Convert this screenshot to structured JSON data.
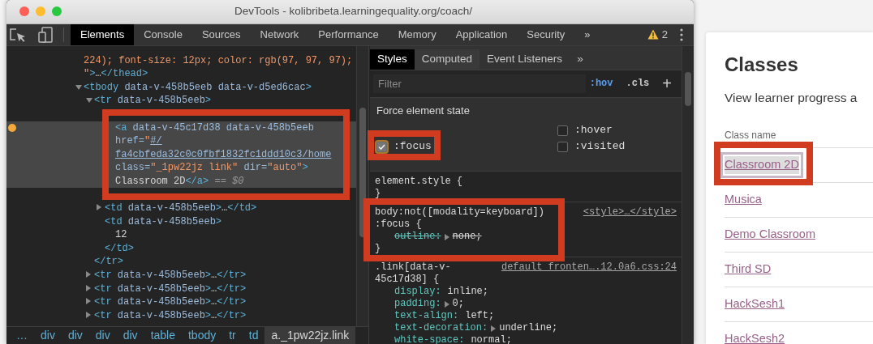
{
  "window": {
    "title": "DevTools - kolibribeta.learningequality.org/coach/"
  },
  "panel_tabs": [
    {
      "label": "Elements",
      "selected": true
    },
    {
      "label": "Console",
      "selected": false
    },
    {
      "label": "Sources",
      "selected": false
    },
    {
      "label": "Network",
      "selected": false
    },
    {
      "label": "Performance",
      "selected": false
    },
    {
      "label": "Memory",
      "selected": false
    },
    {
      "label": "Application",
      "selected": false
    },
    {
      "label": "Security",
      "selected": false
    }
  ],
  "more_tabs": "»",
  "warnings": {
    "count": "2"
  },
  "dom_tree": [
    {
      "selected": false,
      "lines": [
        [
          {
            "kind": "value",
            "text": "224); font-size: 12px; color: rgb(97, 97, 97);"
          }
        ],
        [
          {
            "kind": "value",
            "text": "\""
          },
          {
            "kind": "tag",
            "text": ">"
          },
          {
            "kind": "text",
            "text": "…"
          },
          {
            "kind": "tag",
            "text": "</thead>"
          }
        ]
      ]
    },
    {
      "selected": false,
      "expanded": true,
      "lines": [
        [
          {
            "kind": "tag",
            "text": "<tbody"
          },
          {
            "kind": "attr",
            "text": " data-v-458b5eeb data-v-d5ed6cac"
          },
          {
            "kind": "tag",
            "text": ">"
          }
        ]
      ],
      "children": [
        {
          "selected": false,
          "expanded": true,
          "lines": [
            [
              {
                "kind": "tag",
                "text": "<tr"
              },
              {
                "kind": "attr",
                "text": " data-v-458b5eeb"
              },
              {
                "kind": "tag",
                "text": ">"
              }
            ]
          ],
          "children": [
            {
              "selected": false,
              "marked": true,
              "children": [
                {
                  "selected": true,
                  "lines": [
                    [
                      {
                        "kind": "tag",
                        "text": "<a"
                      },
                      {
                        "kind": "attr",
                        "text": " data-v-45c17d38 data-v-458b5eeb"
                      }
                    ],
                    [
                      {
                        "kind": "attr",
                        "text": "href="
                      },
                      {
                        "kind": "value",
                        "text": "\""
                      },
                      {
                        "kind": "link",
                        "text": "#/"
                      }
                    ],
                    [
                      {
                        "kind": "link",
                        "text": "fa4cbfeda32c0c0fbf1832fc1ddd10c3/home"
                      }
                    ],
                    [
                      {
                        "kind": "attr",
                        "text": "class="
                      },
                      {
                        "kind": "value",
                        "text": "\"_1pw22jz link\""
                      },
                      {
                        "kind": "attr",
                        "text": " dir="
                      },
                      {
                        "kind": "value",
                        "text": "\"auto\""
                      },
                      {
                        "kind": "tag",
                        "text": ">"
                      }
                    ],
                    [
                      {
                        "kind": "text",
                        "text": "Classroom 2D"
                      },
                      {
                        "kind": "tag",
                        "text": "</a>"
                      },
                      {
                        "kind": "dim",
                        "text": " == "
                      },
                      {
                        "kind": "var",
                        "text": "$0"
                      }
                    ]
                  ]
                }
              ]
            },
            {
              "selected": false,
              "expanded": false,
              "lines": [
                [
                  {
                    "kind": "tag",
                    "text": "<td"
                  },
                  {
                    "kind": "attr",
                    "text": " data-v-458b5eeb"
                  },
                  {
                    "kind": "tag",
                    "text": ">"
                  },
                  {
                    "kind": "text",
                    "text": "…"
                  },
                  {
                    "kind": "tag",
                    "text": "</td>"
                  }
                ]
              ]
            },
            {
              "selected": false,
              "lines": [
                [
                  {
                    "kind": "tag",
                    "text": "<td"
                  },
                  {
                    "kind": "attr",
                    "text": " data-v-458b5eeb"
                  },
                  {
                    "kind": "tag",
                    "text": ">"
                  }
                ]
              ],
              "children": [
                {
                  "selected": false,
                  "lines": [
                    [
                      {
                        "kind": "text",
                        "text": "12"
                      }
                    ]
                  ]
                }
              ],
              "close": [
                {
                  "kind": "tag",
                  "text": "</td>"
                }
              ]
            }
          ],
          "close": [
            {
              "kind": "tag",
              "text": "</tr>"
            }
          ]
        },
        {
          "selected": false,
          "expanded": false,
          "lines": [
            [
              {
                "kind": "tag",
                "text": "<tr"
              },
              {
                "kind": "attr",
                "text": " data-v-458b5eeb"
              },
              {
                "kind": "tag",
                "text": ">"
              },
              {
                "kind": "text",
                "text": "…"
              },
              {
                "kind": "tag",
                "text": "</tr>"
              }
            ]
          ]
        },
        {
          "selected": false,
          "expanded": false,
          "lines": [
            [
              {
                "kind": "tag",
                "text": "<tr"
              },
              {
                "kind": "attr",
                "text": " data-v-458b5eeb"
              },
              {
                "kind": "tag",
                "text": ">"
              },
              {
                "kind": "text",
                "text": "…"
              },
              {
                "kind": "tag",
                "text": "</tr>"
              }
            ]
          ]
        },
        {
          "selected": false,
          "expanded": false,
          "lines": [
            [
              {
                "kind": "tag",
                "text": "<tr"
              },
              {
                "kind": "attr",
                "text": " data-v-458b5eeb"
              },
              {
                "kind": "tag",
                "text": ">"
              },
              {
                "kind": "text",
                "text": "…"
              },
              {
                "kind": "tag",
                "text": "</tr>"
              }
            ]
          ]
        },
        {
          "selected": false,
          "expanded": false,
          "lines": [
            [
              {
                "kind": "tag",
                "text": "<tr"
              },
              {
                "kind": "attr",
                "text": " data-v-458b5eeb"
              },
              {
                "kind": "tag",
                "text": ">"
              },
              {
                "kind": "text",
                "text": "…"
              },
              {
                "kind": "tag",
                "text": "</tr>"
              }
            ]
          ]
        }
      ]
    }
  ],
  "breadcrumbs": [
    {
      "label": "…",
      "selected": false
    },
    {
      "label": "div",
      "selected": false
    },
    {
      "label": "div",
      "selected": false
    },
    {
      "label": "div",
      "selected": false
    },
    {
      "label": "div",
      "selected": false
    },
    {
      "label": "table",
      "selected": false
    },
    {
      "label": "tbody",
      "selected": false
    },
    {
      "label": "tr",
      "selected": false
    },
    {
      "label": "td",
      "selected": false
    },
    {
      "label": "a._1pw22jz.link",
      "selected": true
    }
  ],
  "styles_pane": {
    "tabs": [
      {
        "label": "Styles",
        "selected": true
      },
      {
        "label": "Computed",
        "selected": false
      },
      {
        "label": "Event Listeners",
        "selected": false
      }
    ],
    "more_tabs": "»",
    "filter": {
      "placeholder": "Filter"
    },
    "hov": {
      "label": ":hov",
      "on": true
    },
    "cls": ".cls",
    "add": "+",
    "force_state": {
      "title": "Force element state",
      "left_states": [
        {
          "label": ":focus",
          "checked": true,
          "marked": true
        }
      ],
      "right_states": [
        {
          "label": ":hover",
          "checked": false
        },
        {
          "label": ":visited",
          "checked": false
        }
      ]
    },
    "rules": [
      {
        "selector_lines": [
          "element.style {"
        ],
        "close": "}"
      },
      {
        "selector_lines": [
          "body:not([modality=keyboard])",
          ":focus {"
        ],
        "source": "<style>…</style>",
        "marked": true,
        "declarations": [
          {
            "name": "outline:",
            "value": "none;",
            "expandable": true,
            "overridden": true
          }
        ],
        "close": "}"
      },
      {
        "selector_lines": [
          ".link[data-v-",
          "45c17d38] {"
        ],
        "source": "default_fronten….12.0a6.css:24",
        "declarations": [
          {
            "name": "display:",
            "value": "inline;",
            "expandable": false,
            "overridden": false
          },
          {
            "name": "padding:",
            "value": "0;",
            "expandable": true,
            "overridden": false
          },
          {
            "name": "text-align:",
            "value": "left;",
            "expandable": false,
            "overridden": false
          },
          {
            "name": "text-decoration:",
            "value": "underline;",
            "expandable": true,
            "overridden": false
          },
          {
            "name": "white-space:",
            "value": "normal;",
            "expandable": false,
            "overridden": false
          }
        ]
      }
    ]
  },
  "page": {
    "title": "Classes",
    "subtitle": "View learner progress a",
    "column_header": "Class name",
    "classes": [
      {
        "name": "Classroom 2D",
        "focused": true,
        "marked": true
      },
      {
        "name": "Musica",
        "focused": false
      },
      {
        "name": "Demo Classroom",
        "focused": false
      },
      {
        "name": "Third SD",
        "focused": false
      },
      {
        "name": "HackSesh1",
        "focused": false
      },
      {
        "name": "HackSesh2",
        "focused": false
      }
    ]
  }
}
